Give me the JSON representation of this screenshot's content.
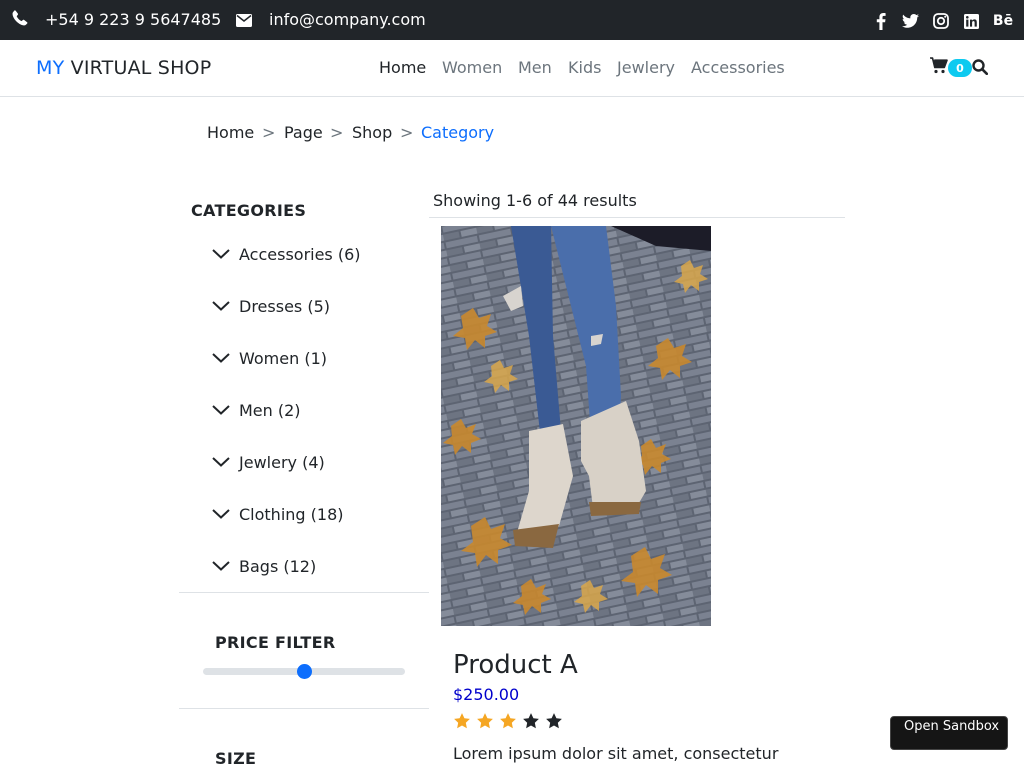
{
  "topbar": {
    "phone": "+54 9 223 9 5647485",
    "email": "info@company.com",
    "social_icons": [
      "facebook-icon",
      "twitter-icon",
      "instagram-icon",
      "linkedin-icon",
      "behance-icon"
    ],
    "behance_text": "Bē"
  },
  "navbar": {
    "brand_accent": "MY",
    "brand_rest": "VIRTUAL SHOP",
    "links": [
      "Home",
      "Women",
      "Men",
      "Kids",
      "Jewlery",
      "Accessories"
    ],
    "active_link": "Home",
    "cart_count": "0"
  },
  "breadcrumb": {
    "items": [
      "Home",
      "Page",
      "Shop",
      "Category"
    ],
    "separator": ">"
  },
  "sidebar": {
    "categories_title": "CATEGORIES",
    "categories": [
      "Accessories (6)",
      "Dresses (5)",
      "Women (1)",
      "Men (2)",
      "Jewlery (4)",
      "Clothing (18)",
      "Bags (12)"
    ],
    "price_filter_title": "PRICE FILTER",
    "price_filter_value": 0.5,
    "size_title": "SIZE"
  },
  "main": {
    "results_text": "Showing 1-6 of 44 results",
    "product": {
      "name": "Product A",
      "price": "$250.00",
      "rating": 3,
      "rating_max": 5,
      "description": "Lorem ipsum dolor sit amet, consectetur"
    }
  },
  "sandbox_button": "Open Sandbox",
  "colors": {
    "accent": "#0d6efd",
    "topbar_bg": "#212529",
    "badge": "#0dcaf0",
    "star_filled": "#f5a623",
    "star_empty": "#212529"
  }
}
